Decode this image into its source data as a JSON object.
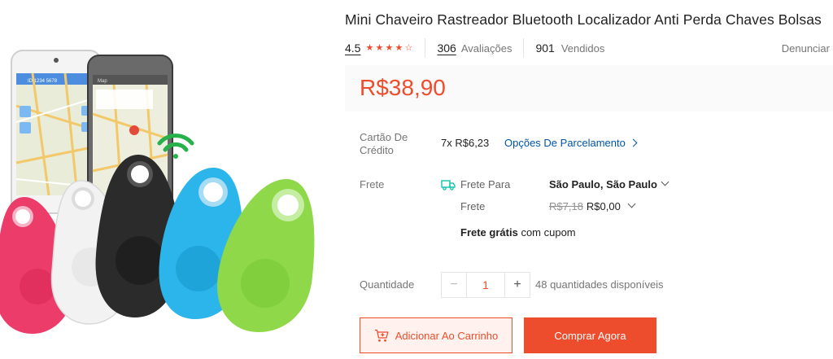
{
  "product": {
    "title": "Mini Chaveiro Rastreador Bluetooth Localizador Anti Perda Chaves Bolsas",
    "rating": "4.5",
    "reviews_count": "306",
    "reviews_label": "Avaliações",
    "sold_count": "901",
    "sold_label": "Vendidos",
    "report_label": "Denunciar",
    "price": "R$38,90"
  },
  "installments": {
    "label": "Cartão De Crédito",
    "value": "7x R$6,23",
    "options_link": "Opções De Parcelamento"
  },
  "shipping": {
    "label": "Frete",
    "to_label": "Frete Para",
    "destination": "São Paulo, São Paulo",
    "fee_label": "Frete",
    "original_fee": "R$7,18",
    "fee": "R$0,00",
    "free_bold": "Frete grátis",
    "free_rest": "com cupom"
  },
  "quantity": {
    "label": "Quantidade",
    "value": "1",
    "available": "48 quantidades disponíveis"
  },
  "actions": {
    "add_to_cart": "Adicionar Ao Carrinho",
    "buy_now": "Comprar Agora"
  },
  "phone": {
    "id_text": "ID 1234 5678",
    "map_label": "Map"
  },
  "colors": {
    "accent": "#ee4d2d",
    "link": "#0055aa",
    "tag_pink": "#ec3d6a",
    "tag_white": "#f2f2f2",
    "tag_black": "#2b2b2b",
    "tag_blue": "#2bb5ea",
    "tag_green": "#8ed84a",
    "wifi": "#27b14a"
  },
  "icons": [
    "star-icon",
    "chevron-right-icon",
    "chevron-down-icon",
    "truck-icon",
    "cart-plus-icon",
    "minus-icon",
    "plus-icon",
    "wifi-signal-icon"
  ]
}
